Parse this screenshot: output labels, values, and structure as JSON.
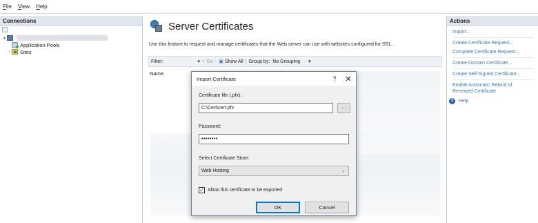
{
  "menu": {
    "file": "File",
    "view": "View",
    "help": "Help"
  },
  "connections": {
    "header": "Connections",
    "tree": {
      "app_pools": "Application Pools",
      "sites": "Sites"
    }
  },
  "center": {
    "title": "Server Certificates",
    "description": "Use this feature to request and manage certificates that the Web server can use with websites configured for SSL.",
    "filter_label": "Filter:",
    "go_label": "Go",
    "show_all_label": "Show All",
    "group_by_label": "Group by:",
    "group_by_value": "No Grouping",
    "column_name": "Name"
  },
  "actions": {
    "header": "Actions",
    "items": [
      "Import...",
      "Create Certificate Request...",
      "Complete Certificate Request...",
      "Create Domain Certificate...",
      "Create Self-Signed Certificate...",
      "Enable Automatic Rebind of Renewed Certificate"
    ],
    "help": "Help"
  },
  "dialog": {
    "title": "Import Certificate",
    "help_glyph": "?",
    "close_glyph": "✕",
    "file_label": "Certificate file (.pfx):",
    "file_value": "C:\\Cert\\cert.pfx",
    "browse_label": "...",
    "password_label": "Password:",
    "password_value": "••••••••",
    "store_label": "Select Certificate Store:",
    "store_value": "Web Hosting",
    "export_label": "Allow this certificate to be exported",
    "export_checked": true,
    "ok_label": "OK",
    "cancel_label": "Cancel"
  }
}
